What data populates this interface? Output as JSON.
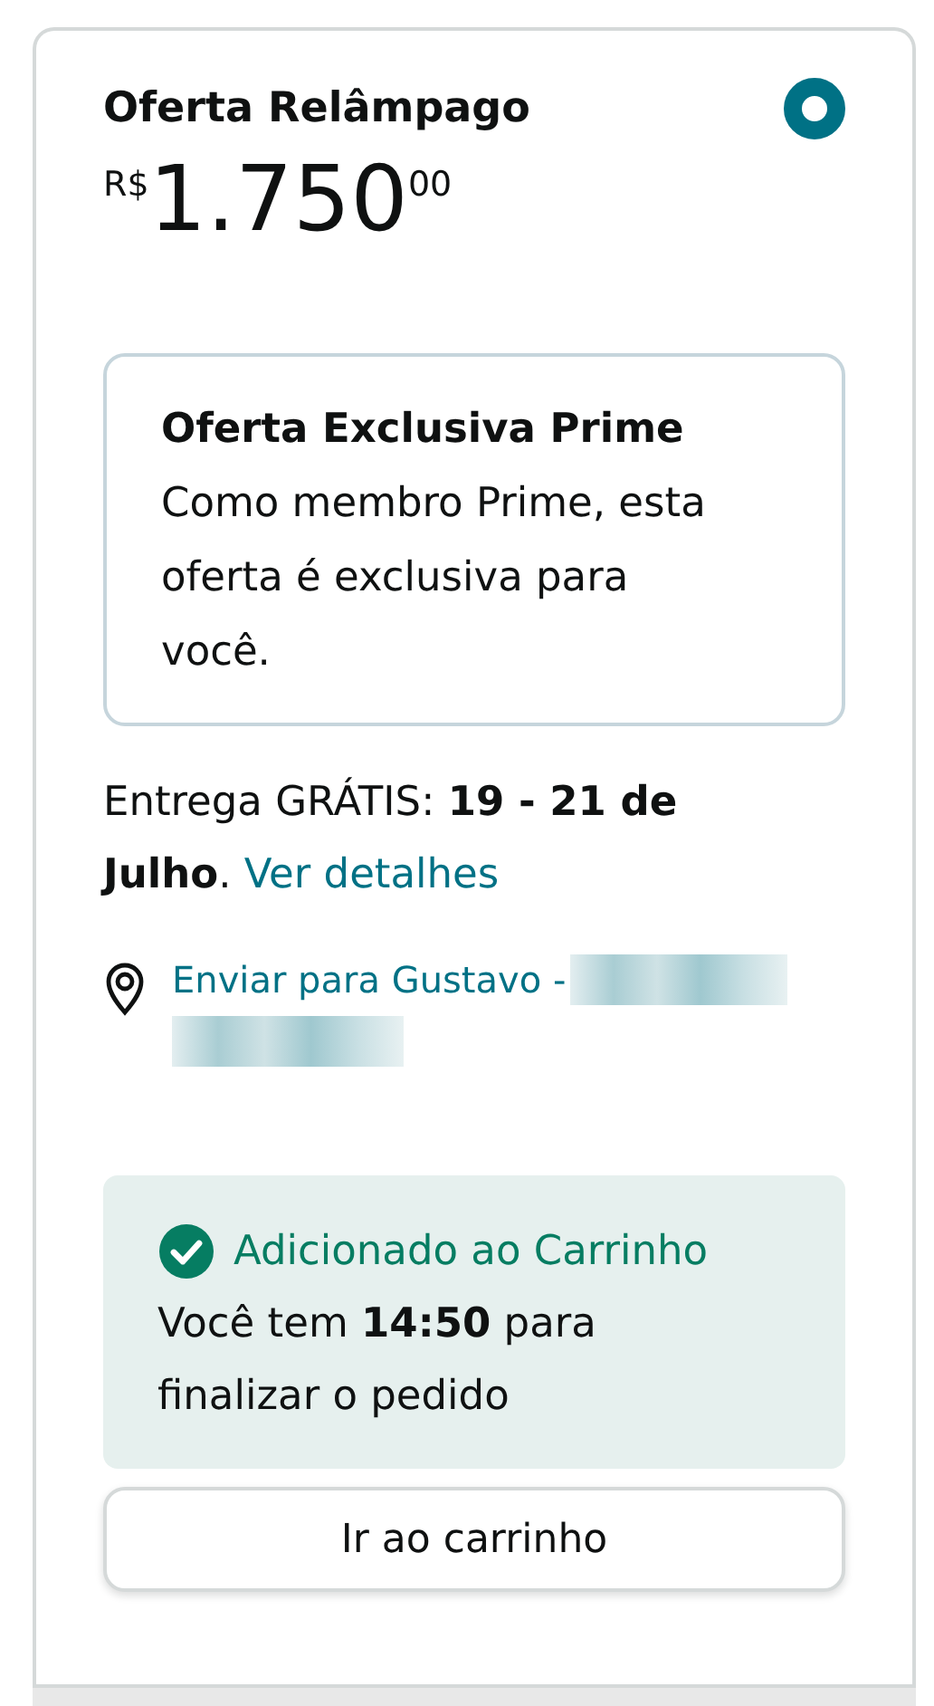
{
  "offer": {
    "title": "Oferta Relâmpago",
    "selected": true
  },
  "price": {
    "currency": "R$",
    "whole": "1.750",
    "fraction": "00"
  },
  "prime_box": {
    "title": "Oferta Exclusiva Prime",
    "text": "Como membro Prime, esta oferta é exclusiva para você."
  },
  "delivery": {
    "text": "Entrega GRÁTIS: **19 - 21 de Julho**. ",
    "link": "Ver detalhes"
  },
  "address": {
    "link": "Enviar para Gustavo -"
  },
  "cart_notice": {
    "status": "Adicionado ao Carrinho",
    "message": "Você tem **14:50** para finalizar o pedido"
  },
  "button": {
    "label": "Ir ao carrinho"
  }
}
